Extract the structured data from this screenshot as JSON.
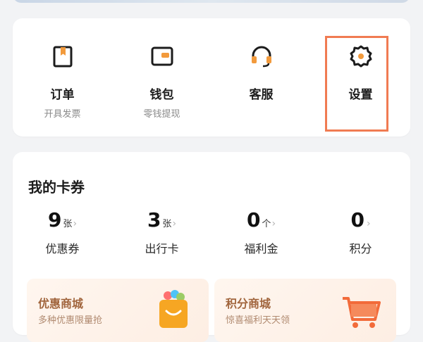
{
  "services": [
    {
      "label": "订单",
      "sub": "开具发票",
      "icon": "order-icon"
    },
    {
      "label": "钱包",
      "sub": "零钱提现",
      "icon": "wallet-icon"
    },
    {
      "label": "客服",
      "sub": "",
      "icon": "headset-icon"
    },
    {
      "label": "设置",
      "sub": "",
      "icon": "settings-gear-icon"
    }
  ],
  "coupons": {
    "title": "我的卡券",
    "items": [
      {
        "value": "9",
        "unit": "张",
        "label": "优惠券"
      },
      {
        "value": "3",
        "unit": "张",
        "label": "出行卡"
      },
      {
        "value": "0",
        "unit": "个",
        "label": "福利金"
      },
      {
        "value": "0",
        "unit": "",
        "label": "积分"
      }
    ]
  },
  "promos": [
    {
      "title": "优惠商城",
      "sub": "多种优惠限量抢",
      "icon": "shopping-bag-icon"
    },
    {
      "title": "积分商城",
      "sub": "惊喜福利天天领",
      "icon": "shopping-cart-icon"
    }
  ],
  "colors": {
    "accent": "#f07b52",
    "orange": "#f29a3c",
    "dark": "#1c1c1c"
  }
}
